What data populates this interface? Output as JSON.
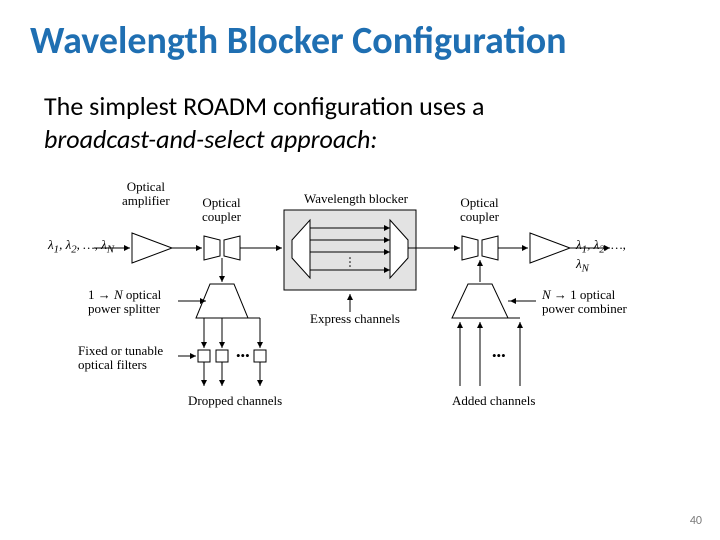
{
  "title": "Wavelength Blocker Configuration",
  "body_line1": "The simplest ROADM configuration uses a",
  "body_line2": "broadcast-and-select approach:",
  "page_number": "40",
  "diagram": {
    "optical_amplifier": "Optical\namplifier",
    "optical_coupler_left": "Optical\ncoupler",
    "optical_coupler_right": "Optical\ncoupler",
    "wavelength_blocker": "Wavelength blocker",
    "lambda_in": "λ1, λ2, …, λN",
    "lambda_out": "λ1, λ2, …, λN",
    "splitter": "1 → N optical\npower splitter",
    "combiner": "N → 1 optical\npower combiner",
    "filters": "Fixed or tunable\noptical filters",
    "dropped": "Dropped channels",
    "added": "Added channels",
    "express": "Express channels",
    "dots": "• • •"
  }
}
